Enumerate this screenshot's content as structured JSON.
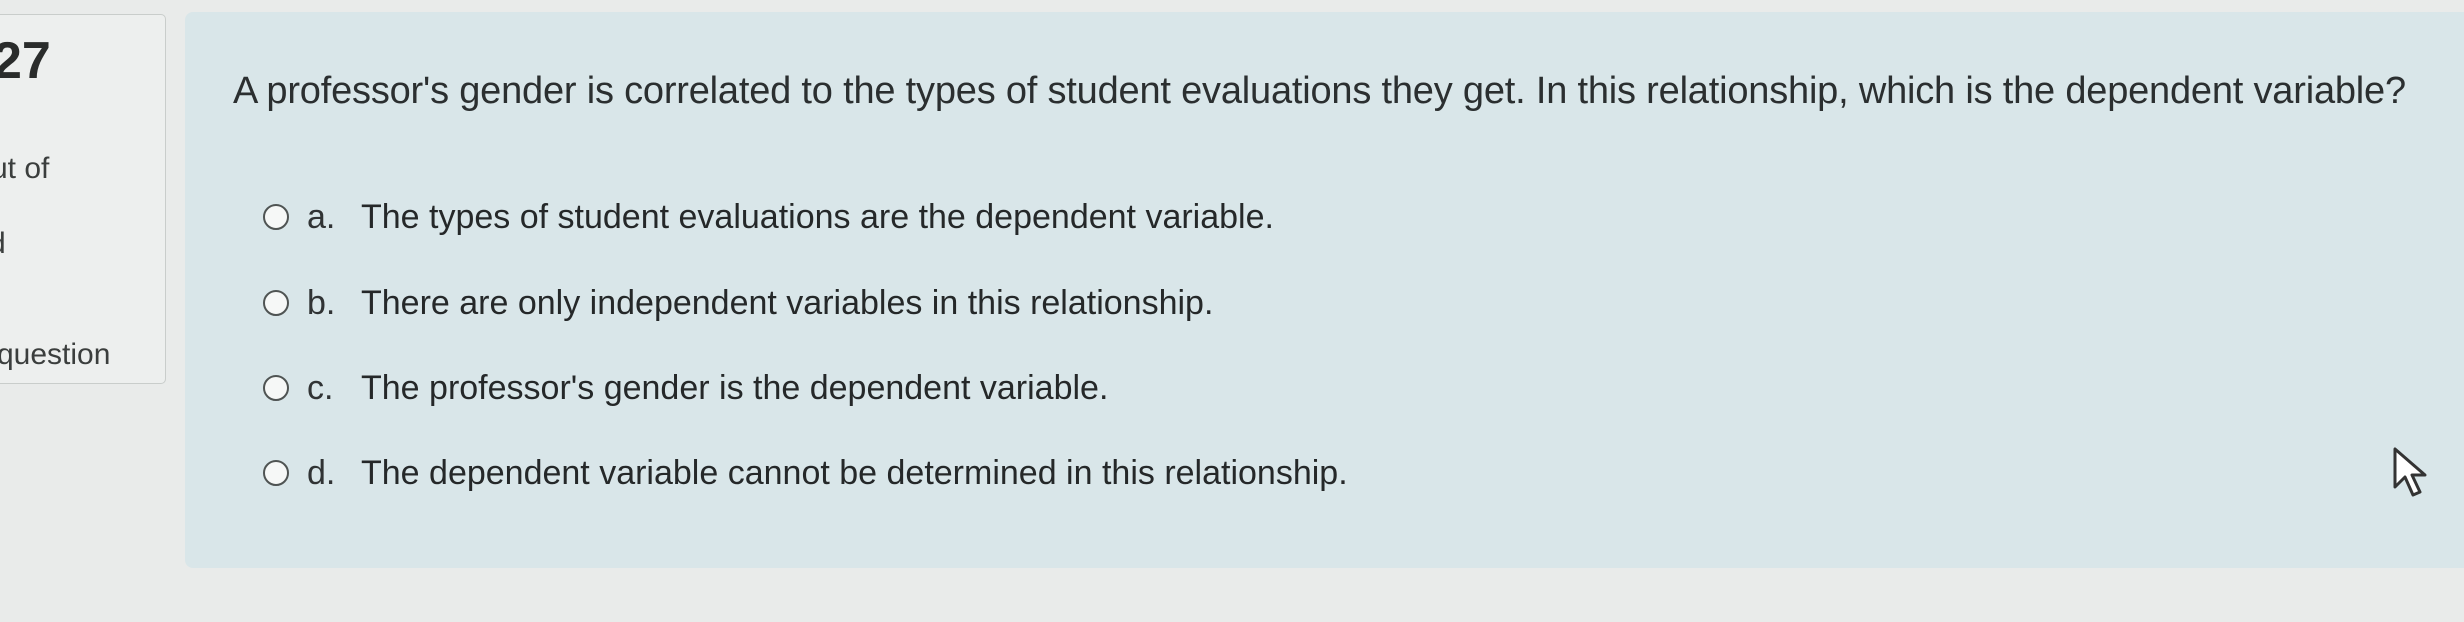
{
  "sidebar": {
    "question_number": "27",
    "status": "ut of",
    "mark": "d",
    "flag_label": "question"
  },
  "question": {
    "text": "A professor's gender is correlated to the types of student evaluations they get. In this relationship, which is the dependent variable?",
    "options": [
      {
        "letter": "a.",
        "text": "The types of student evaluations are the dependent variable."
      },
      {
        "letter": "b.",
        "text": "There are only independent variables in this relationship."
      },
      {
        "letter": "c.",
        "text": "The professor's gender is the dependent variable."
      },
      {
        "letter": "d.",
        "text": "The dependent variable cannot be determined in this relationship."
      }
    ]
  },
  "colors": {
    "card_background": "#d9e6e9",
    "page_background": "#e9ebea"
  },
  "icons": {
    "radio": "radio-button-icon",
    "pointer": "mouse-pointer-icon"
  }
}
